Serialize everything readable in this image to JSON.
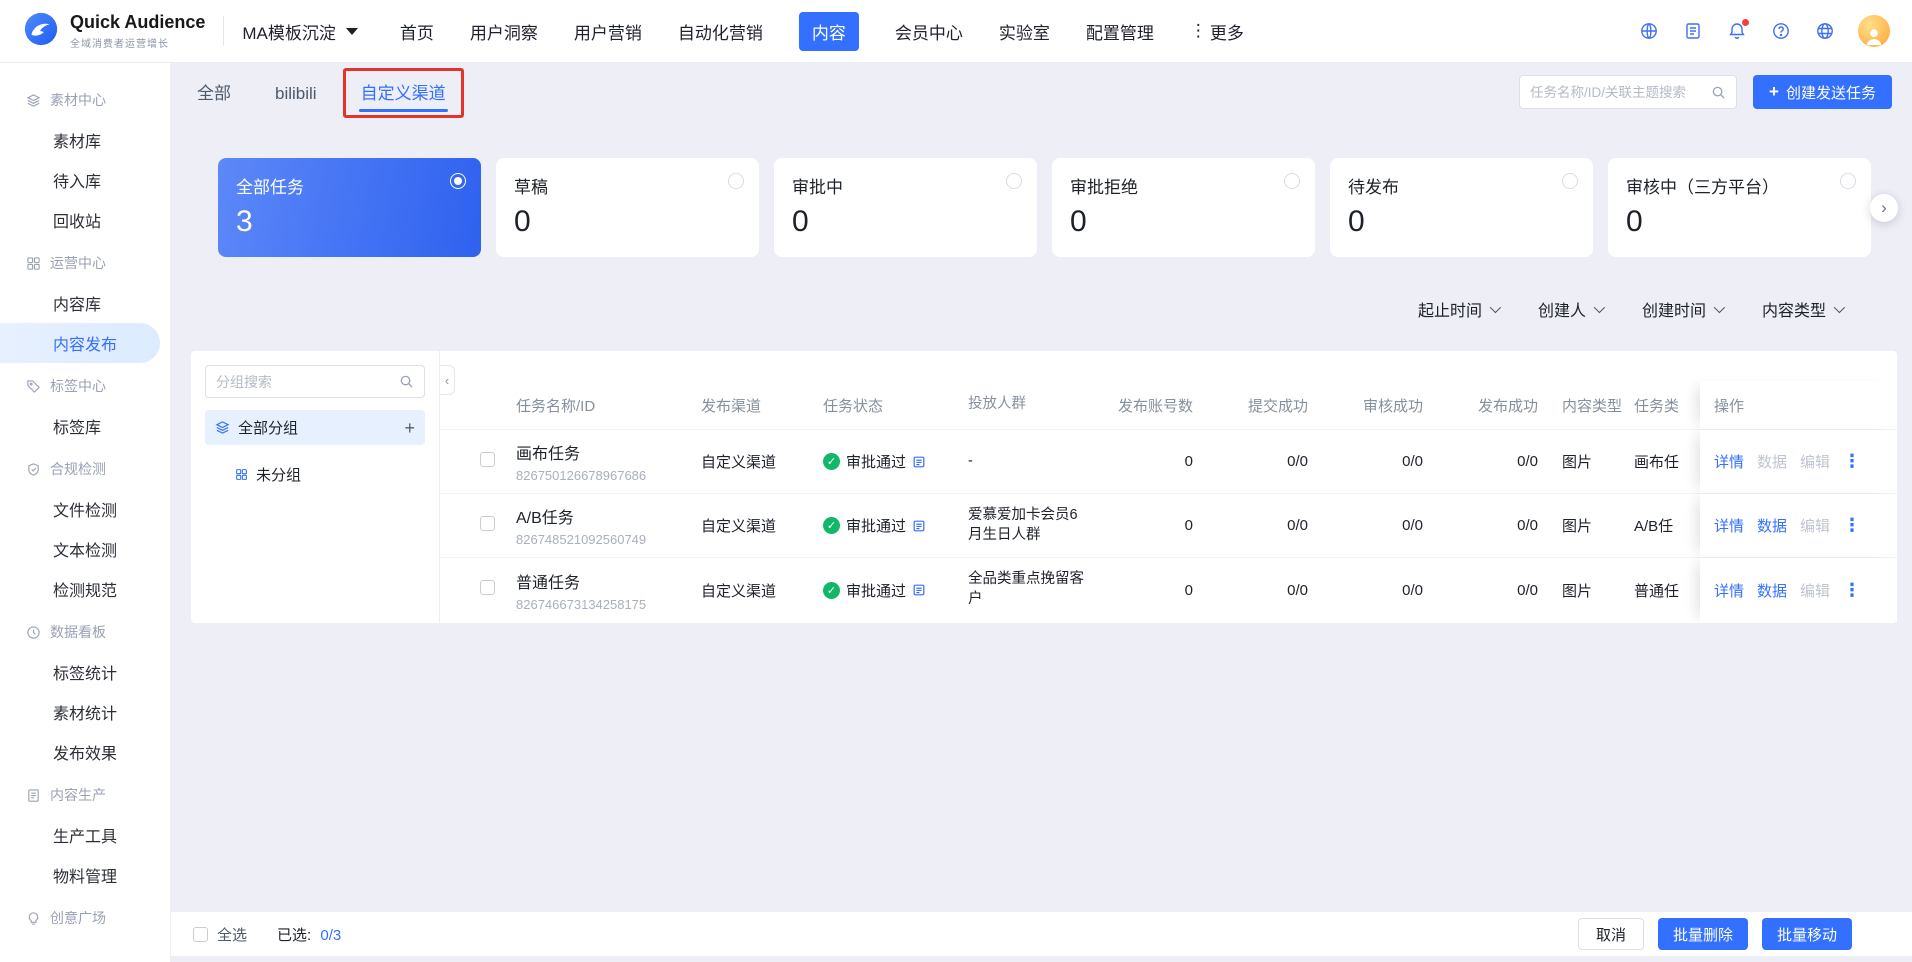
{
  "colors": {
    "primary": "#3370ff",
    "success": "#12b76a",
    "annotation_red": "#e2342b",
    "background": "#edeef6",
    "card_gradient_start": "#5d88f9",
    "card_gradient_end": "#2e61ef"
  },
  "icons": {
    "check": "✓",
    "plus": "+",
    "kebab": "⋮",
    "more_vertical": "⋮",
    "chevron_left": "‹",
    "chevron_right": "›"
  },
  "topbar": {
    "brand": {
      "name": "Quick Audience",
      "subtitle": "全域消费者运营增长"
    },
    "workspace": "MA模板沉淀",
    "nav": [
      {
        "label": "首页",
        "active": false
      },
      {
        "label": "用户洞察",
        "active": false
      },
      {
        "label": "用户营销",
        "active": false
      },
      {
        "label": "自动化营销",
        "active": false
      },
      {
        "label": "内容",
        "active": true
      },
      {
        "label": "会员中心",
        "active": false
      },
      {
        "label": "实验室",
        "active": false
      },
      {
        "label": "配置管理",
        "active": false
      },
      {
        "label": "更多",
        "active": false
      }
    ]
  },
  "sidebar": {
    "active_item": "内容发布",
    "sections": [
      {
        "title": "素材中心",
        "icon": "layers-icon",
        "items": [
          "素材库",
          "待入库",
          "回收站"
        ]
      },
      {
        "title": "运营中心",
        "icon": "grid-icon",
        "items": [
          "内容库",
          "内容发布"
        ]
      },
      {
        "title": "标签中心",
        "icon": "tag-icon",
        "items": [
          "标签库"
        ]
      },
      {
        "title": "合规检测",
        "icon": "shield-check-icon",
        "items": [
          "文件检测",
          "文本检测",
          "检测规范"
        ]
      },
      {
        "title": "数据看板",
        "icon": "clock-icon",
        "items": [
          "标签统计",
          "素材统计",
          "发布效果"
        ]
      },
      {
        "title": "内容生产",
        "icon": "file-icon",
        "items": [
          "生产工具",
          "物料管理"
        ]
      },
      {
        "title": "创意广场",
        "icon": "idea-icon",
        "items": []
      }
    ]
  },
  "content": {
    "tabs": [
      {
        "label": "全部",
        "active": false
      },
      {
        "label": "bilibili",
        "active": false
      },
      {
        "label": "自定义渠道",
        "active": true,
        "annotated": true
      }
    ],
    "search_placeholder": "任务名称/ID/关联主题搜索",
    "create_button": "创建发送任务",
    "status_cards": [
      {
        "label": "全部任务",
        "count": "3",
        "selected": true
      },
      {
        "label": "草稿",
        "count": "0",
        "selected": false
      },
      {
        "label": "审批中",
        "count": "0",
        "selected": false
      },
      {
        "label": "审批拒绝",
        "count": "0",
        "selected": false
      },
      {
        "label": "待发布",
        "count": "0",
        "selected": false
      },
      {
        "label": "审核中（三方平台）",
        "count": "0",
        "selected": false
      }
    ],
    "filters": [
      {
        "label": "起止时间"
      },
      {
        "label": "创建人"
      },
      {
        "label": "创建时间"
      },
      {
        "label": "内容类型"
      }
    ],
    "groups": {
      "search_placeholder": "分组搜索",
      "all_label": "全部分组",
      "items": [
        "未分组"
      ]
    },
    "table": {
      "headers": [
        "任务名称/ID",
        "发布渠道",
        "任务状态",
        "投放人群",
        "发布账号数",
        "提交成功",
        "审核成功",
        "发布成功",
        "内容类型",
        "任务类",
        "操作"
      ],
      "action_labels": {
        "detail": "详情",
        "data": "数据",
        "edit": "编辑"
      },
      "rows": [
        {
          "name": "画布任务",
          "id": "826750126678967686",
          "channel": "自定义渠道",
          "status": "审批通过",
          "audience": "-",
          "accounts": "0",
          "submitted": "0/0",
          "reviewed": "0/0",
          "published": "0/0",
          "content_type": "图片",
          "task_type": "画布任",
          "data_enabled": false,
          "edit_enabled": false
        },
        {
          "name": "A/B任务",
          "id": "826748521092560749",
          "channel": "自定义渠道",
          "status": "审批通过",
          "audience": "爱慕爱加卡会员6月生日人群",
          "accounts": "0",
          "submitted": "0/0",
          "reviewed": "0/0",
          "published": "0/0",
          "content_type": "图片",
          "task_type": "A/B任",
          "data_enabled": true,
          "edit_enabled": false
        },
        {
          "name": "普通任务",
          "id": "826746673134258175",
          "channel": "自定义渠道",
          "status": "审批通过",
          "audience": "全品类重点挽留客户",
          "accounts": "0",
          "submitted": "0/0",
          "reviewed": "0/0",
          "published": "0/0",
          "content_type": "图片",
          "task_type": "普通任",
          "data_enabled": true,
          "edit_enabled": false
        }
      ]
    }
  },
  "footer": {
    "select_all": "全选",
    "selected_prefix": "已选:",
    "selected_count": "0/3",
    "cancel": "取消",
    "batch_delete": "批量删除",
    "batch_move": "批量移动"
  }
}
